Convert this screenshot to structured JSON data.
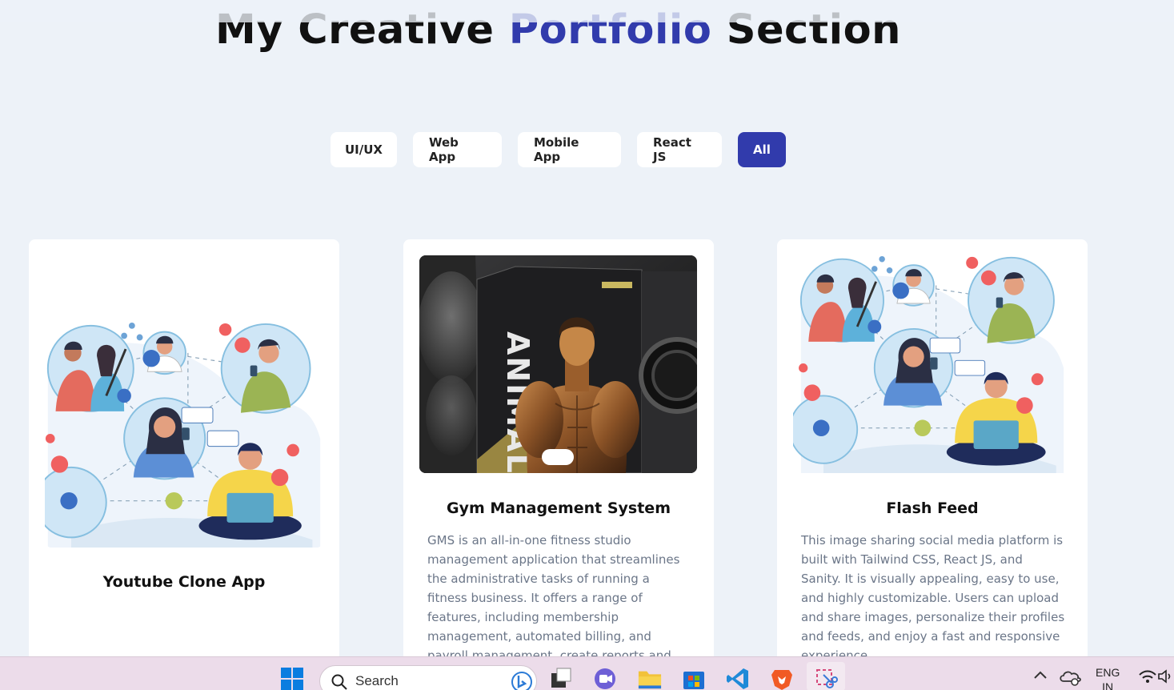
{
  "section": {
    "title_before": "My Creative",
    "title_accent": "Portfolio",
    "title_after": "Section",
    "accent_color": "#313bac"
  },
  "filters": [
    {
      "label": "UI/UX",
      "active": false
    },
    {
      "label": "Web App",
      "active": false
    },
    {
      "label": "Mobile App",
      "active": false
    },
    {
      "label": "React JS",
      "active": false
    },
    {
      "label": "All",
      "active": true
    }
  ],
  "projects": [
    {
      "title": "Youtube Clone App",
      "description": "",
      "image": "social-network-illustration"
    },
    {
      "title": "Gym Management System",
      "description": "GMS is an all-in-one fitness studio management application that streamlines the administrative tasks of running a fitness business. It offers a range of features, including membership management, automated billing, and payroll management, create reports and much more.",
      "image": "bodybuilder-poster",
      "image_text": "ANIMAL"
    },
    {
      "title": "Flash Feed",
      "description": "This image sharing social media platform is built with Tailwind CSS, React JS, and Sanity. It is visually appealing, easy to use, and highly customizable. Users can upload and share images, personalize their profiles and feeds, and enjoy a fast and responsive experience.",
      "image": "social-network-illustration"
    }
  ],
  "taskbar": {
    "search_placeholder": "Search",
    "lang_line1": "ENG",
    "lang_line2": "IN",
    "icons": [
      "windows-start-icon",
      "search-icon",
      "bing-icon",
      "task-view-icon",
      "teams-chat-icon",
      "file-explorer-icon",
      "microsoft-store-icon",
      "vscode-icon",
      "brave-browser-icon",
      "snipping-tool-icon",
      "chevron-up-icon",
      "onedrive-icon",
      "wifi-icon",
      "volume-icon"
    ]
  }
}
